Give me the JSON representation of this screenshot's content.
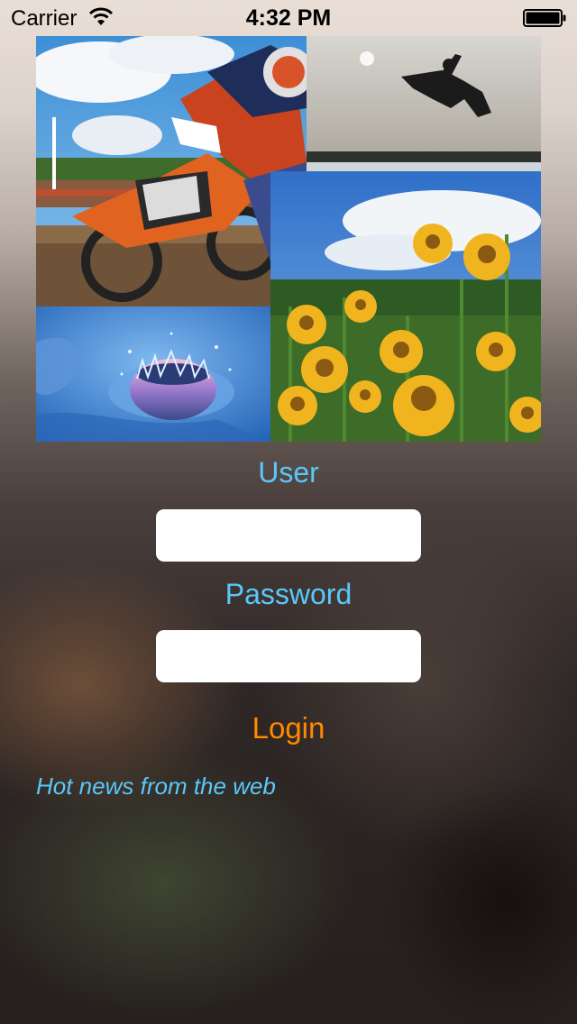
{
  "status_bar": {
    "carrier": "Carrier",
    "time": "4:32 PM",
    "wifi_icon": "wifi-icon",
    "battery_icon": "battery-icon"
  },
  "collage": {
    "tiles": [
      "motocross",
      "jump-silhouette",
      "sunflowers",
      "water-drop"
    ]
  },
  "form": {
    "user_label": "User",
    "user_value": "",
    "password_label": "Password",
    "password_value": "",
    "login_label": "Login"
  },
  "news": {
    "text": "Hot news from the web"
  },
  "colors": {
    "label": "#5ac8fa",
    "login": "#ff8a00",
    "field_bg": "#ffffff"
  }
}
